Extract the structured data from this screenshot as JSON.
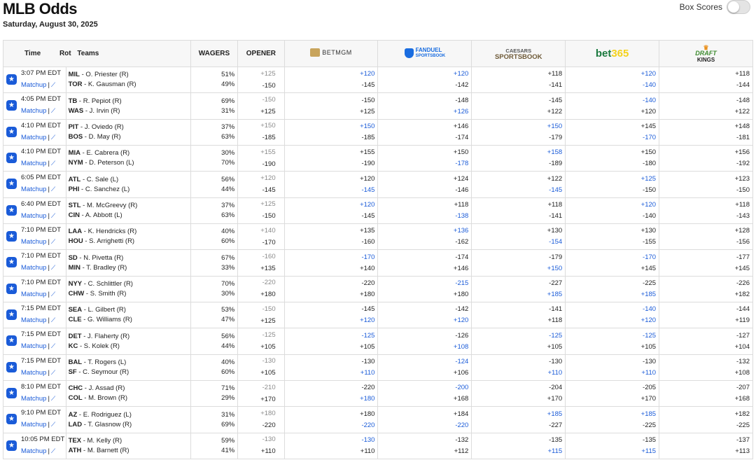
{
  "header": {
    "title": "MLB Odds",
    "date": "Saturday, August 30, 2025",
    "box_scores_label": "Box Scores"
  },
  "columns": {
    "time": "Time",
    "rot": "Rot",
    "teams": "Teams",
    "wagers": "WAGERS",
    "opener": "OPENER"
  },
  "books": {
    "betmgm": "BETMGM",
    "fanduel": "FANDUEL",
    "fanduel_sub": "SPORTSBOOK",
    "caesars": "CAESARS",
    "caesars_sub": "SPORTSBOOK",
    "bet365_a": "bet",
    "bet365_b": "365",
    "draftkings_a": "DRAFT",
    "draftkings_b": "KINGS"
  },
  "colors": {
    "link_blue": "#1a5bd8",
    "muted": "#8a8a8a"
  },
  "matchup_label": "Matchup",
  "games": [
    {
      "time": "3:07 PM EDT",
      "away": "MIL",
      "away_p": "O. Priester (R)",
      "home": "TOR",
      "home_p": "K. Gausman (R)",
      "w1": "51%",
      "w2": "49%",
      "o1": "+125",
      "o2": "-150",
      "mgm": [
        "+120",
        "-145"
      ],
      "fd": [
        "+120",
        "-142"
      ],
      "cz": [
        "+118",
        "-141"
      ],
      "b365": [
        "+120",
        "-140"
      ],
      "dk": [
        "+118",
        "-144"
      ],
      "blue": {
        "mgm": [
          1,
          0
        ],
        "fd": [
          1,
          0
        ],
        "cz": [
          0,
          0
        ],
        "b365": [
          1,
          1
        ],
        "dk": [
          0,
          0
        ]
      }
    },
    {
      "time": "4:05 PM EDT",
      "away": "TB",
      "away_p": "R. Pepiot (R)",
      "home": "WAS",
      "home_p": "J. Irvin (R)",
      "w1": "69%",
      "w2": "31%",
      "o1": "-150",
      "o2": "+125",
      "mgm": [
        "-150",
        "+125"
      ],
      "fd": [
        "-148",
        "+126"
      ],
      "cz": [
        "-145",
        "+122"
      ],
      "b365": [
        "-140",
        "+120"
      ],
      "dk": [
        "-148",
        "+122"
      ],
      "blue": {
        "mgm": [
          0,
          0
        ],
        "fd": [
          0,
          1
        ],
        "cz": [
          0,
          0
        ],
        "b365": [
          1,
          0
        ],
        "dk": [
          0,
          0
        ]
      }
    },
    {
      "time": "4:10 PM EDT",
      "away": "PIT",
      "away_p": "J. Oviedo (R)",
      "home": "BOS",
      "home_p": "D. May (R)",
      "w1": "37%",
      "w2": "63%",
      "o1": "+150",
      "o2": "-185",
      "mgm": [
        "+150",
        "-185"
      ],
      "fd": [
        "+146",
        "-174"
      ],
      "cz": [
        "+150",
        "-179"
      ],
      "b365": [
        "+145",
        "-170"
      ],
      "dk": [
        "+148",
        "-181"
      ],
      "blue": {
        "mgm": [
          1,
          0
        ],
        "fd": [
          0,
          0
        ],
        "cz": [
          1,
          0
        ],
        "b365": [
          0,
          1
        ],
        "dk": [
          0,
          0
        ]
      }
    },
    {
      "time": "4:10 PM EDT",
      "away": "MIA",
      "away_p": "E. Cabrera (R)",
      "home": "NYM",
      "home_p": "D. Peterson (L)",
      "w1": "30%",
      "w2": "70%",
      "o1": "+155",
      "o2": "-190",
      "mgm": [
        "+155",
        "-190"
      ],
      "fd": [
        "+150",
        "-178"
      ],
      "cz": [
        "+158",
        "-189"
      ],
      "b365": [
        "+150",
        "-180"
      ],
      "dk": [
        "+156",
        "-192"
      ],
      "blue": {
        "mgm": [
          0,
          0
        ],
        "fd": [
          0,
          1
        ],
        "cz": [
          1,
          0
        ],
        "b365": [
          0,
          0
        ],
        "dk": [
          0,
          0
        ]
      }
    },
    {
      "time": "6:05 PM EDT",
      "away": "ATL",
      "away_p": "C. Sale (L)",
      "home": "PHI",
      "home_p": "C. Sanchez (L)",
      "w1": "56%",
      "w2": "44%",
      "o1": "+120",
      "o2": "-145",
      "mgm": [
        "+120",
        "-145"
      ],
      "fd": [
        "+124",
        "-146"
      ],
      "cz": [
        "+122",
        "-145"
      ],
      "b365": [
        "+125",
        "-150"
      ],
      "dk": [
        "+123",
        "-150"
      ],
      "blue": {
        "mgm": [
          0,
          1
        ],
        "fd": [
          0,
          0
        ],
        "cz": [
          0,
          1
        ],
        "b365": [
          1,
          0
        ],
        "dk": [
          0,
          0
        ]
      }
    },
    {
      "time": "6:40 PM EDT",
      "away": "STL",
      "away_p": "M. McGreevy (R)",
      "home": "CIN",
      "home_p": "A. Abbott (L)",
      "w1": "37%",
      "w2": "63%",
      "o1": "+125",
      "o2": "-150",
      "mgm": [
        "+120",
        "-145"
      ],
      "fd": [
        "+118",
        "-138"
      ],
      "cz": [
        "+118",
        "-141"
      ],
      "b365": [
        "+120",
        "-140"
      ],
      "dk": [
        "+118",
        "-143"
      ],
      "blue": {
        "mgm": [
          1,
          0
        ],
        "fd": [
          0,
          1
        ],
        "cz": [
          0,
          0
        ],
        "b365": [
          1,
          0
        ],
        "dk": [
          0,
          0
        ]
      }
    },
    {
      "time": "7:10 PM EDT",
      "away": "LAA",
      "away_p": "K. Hendricks (R)",
      "home": "HOU",
      "home_p": "S. Arrighetti (R)",
      "w1": "40%",
      "w2": "60%",
      "o1": "+140",
      "o2": "-170",
      "mgm": [
        "+135",
        "-160"
      ],
      "fd": [
        "+136",
        "-162"
      ],
      "cz": [
        "+130",
        "-154"
      ],
      "b365": [
        "+130",
        "-155"
      ],
      "dk": [
        "+128",
        "-156"
      ],
      "blue": {
        "mgm": [
          0,
          0
        ],
        "fd": [
          1,
          0
        ],
        "cz": [
          0,
          1
        ],
        "b365": [
          0,
          0
        ],
        "dk": [
          0,
          0
        ]
      }
    },
    {
      "time": "7:10 PM EDT",
      "away": "SD",
      "away_p": "N. Pivetta (R)",
      "home": "MIN",
      "home_p": "T. Bradley (R)",
      "w1": "67%",
      "w2": "33%",
      "o1": "-160",
      "o2": "+135",
      "mgm": [
        "-170",
        "+140"
      ],
      "fd": [
        "-174",
        "+146"
      ],
      "cz": [
        "-179",
        "+150"
      ],
      "b365": [
        "-170",
        "+145"
      ],
      "dk": [
        "-177",
        "+145"
      ],
      "blue": {
        "mgm": [
          1,
          0
        ],
        "fd": [
          0,
          0
        ],
        "cz": [
          0,
          1
        ],
        "b365": [
          1,
          0
        ],
        "dk": [
          0,
          0
        ]
      }
    },
    {
      "time": "7:10 PM EDT",
      "away": "NYY",
      "away_p": "C. Schlittler (R)",
      "home": "CHW",
      "home_p": "S. Smith (R)",
      "w1": "70%",
      "w2": "30%",
      "o1": "-220",
      "o2": "+180",
      "mgm": [
        "-220",
        "+180"
      ],
      "fd": [
        "-215",
        "+180"
      ],
      "cz": [
        "-227",
        "+185"
      ],
      "b365": [
        "-225",
        "+185"
      ],
      "dk": [
        "-226",
        "+182"
      ],
      "blue": {
        "mgm": [
          0,
          0
        ],
        "fd": [
          1,
          0
        ],
        "cz": [
          0,
          1
        ],
        "b365": [
          0,
          1
        ],
        "dk": [
          0,
          0
        ]
      }
    },
    {
      "time": "7:15 PM EDT",
      "away": "SEA",
      "away_p": "L. Gilbert (R)",
      "home": "CLE",
      "home_p": "G. Williams (R)",
      "w1": "53%",
      "w2": "47%",
      "o1": "-150",
      "o2": "+125",
      "mgm": [
        "-145",
        "+120"
      ],
      "fd": [
        "-142",
        "+120"
      ],
      "cz": [
        "-141",
        "+118"
      ],
      "b365": [
        "-140",
        "+120"
      ],
      "dk": [
        "-144",
        "+119"
      ],
      "blue": {
        "mgm": [
          0,
          1
        ],
        "fd": [
          0,
          1
        ],
        "cz": [
          0,
          0
        ],
        "b365": [
          1,
          1
        ],
        "dk": [
          0,
          0
        ]
      }
    },
    {
      "time": "7:15 PM EDT",
      "away": "DET",
      "away_p": "J. Flaherty (R)",
      "home": "KC",
      "home_p": "S. Kolek (R)",
      "w1": "56%",
      "w2": "44%",
      "o1": "-125",
      "o2": "+105",
      "mgm": [
        "-125",
        "+105"
      ],
      "fd": [
        "-126",
        "+108"
      ],
      "cz": [
        "-125",
        "+105"
      ],
      "b365": [
        "-125",
        "+105"
      ],
      "dk": [
        "-127",
        "+104"
      ],
      "blue": {
        "mgm": [
          1,
          0
        ],
        "fd": [
          0,
          1
        ],
        "cz": [
          1,
          0
        ],
        "b365": [
          1,
          0
        ],
        "dk": [
          0,
          0
        ]
      }
    },
    {
      "time": "7:15 PM EDT",
      "away": "BAL",
      "away_p": "T. Rogers (L)",
      "home": "SF",
      "home_p": "C. Seymour (R)",
      "w1": "40%",
      "w2": "60%",
      "o1": "-130",
      "o2": "+105",
      "mgm": [
        "-130",
        "+110"
      ],
      "fd": [
        "-124",
        "+106"
      ],
      "cz": [
        "-130",
        "+110"
      ],
      "b365": [
        "-130",
        "+110"
      ],
      "dk": [
        "-132",
        "+108"
      ],
      "blue": {
        "mgm": [
          0,
          1
        ],
        "fd": [
          1,
          0
        ],
        "cz": [
          0,
          1
        ],
        "b365": [
          0,
          1
        ],
        "dk": [
          0,
          0
        ]
      }
    },
    {
      "time": "8:10 PM EDT",
      "away": "CHC",
      "away_p": "J. Assad (R)",
      "home": "COL",
      "home_p": "M. Brown (R)",
      "w1": "71%",
      "w2": "29%",
      "o1": "-210",
      "o2": "+170",
      "mgm": [
        "-220",
        "+180"
      ],
      "fd": [
        "-200",
        "+168"
      ],
      "cz": [
        "-204",
        "+170"
      ],
      "b365": [
        "-205",
        "+170"
      ],
      "dk": [
        "-207",
        "+168"
      ],
      "blue": {
        "mgm": [
          0,
          1
        ],
        "fd": [
          1,
          0
        ],
        "cz": [
          0,
          0
        ],
        "b365": [
          0,
          0
        ],
        "dk": [
          0,
          0
        ]
      }
    },
    {
      "time": "9:10 PM EDT",
      "away": "AZ",
      "away_p": "E. Rodriguez (L)",
      "home": "LAD",
      "home_p": "T. Glasnow (R)",
      "w1": "31%",
      "w2": "69%",
      "o1": "+180",
      "o2": "-220",
      "mgm": [
        "+180",
        "-220"
      ],
      "fd": [
        "+184",
        "-220"
      ],
      "cz": [
        "+185",
        "-227"
      ],
      "b365": [
        "+185",
        "-225"
      ],
      "dk": [
        "+182",
        "-225"
      ],
      "blue": {
        "mgm": [
          0,
          1
        ],
        "fd": [
          0,
          1
        ],
        "cz": [
          1,
          0
        ],
        "b365": [
          1,
          0
        ],
        "dk": [
          0,
          0
        ]
      }
    },
    {
      "time": "10:05 PM EDT",
      "away": "TEX",
      "away_p": "M. Kelly (R)",
      "home": "ATH",
      "home_p": "M. Barnett (R)",
      "w1": "59%",
      "w2": "41%",
      "o1": "-130",
      "o2": "+110",
      "mgm": [
        "-130",
        "+110"
      ],
      "fd": [
        "-132",
        "+112"
      ],
      "cz": [
        "-135",
        "+115"
      ],
      "b365": [
        "-135",
        "+115"
      ],
      "dk": [
        "-137",
        "+113"
      ],
      "blue": {
        "mgm": [
          1,
          0
        ],
        "fd": [
          0,
          0
        ],
        "cz": [
          0,
          1
        ],
        "b365": [
          0,
          1
        ],
        "dk": [
          0,
          0
        ]
      }
    }
  ]
}
